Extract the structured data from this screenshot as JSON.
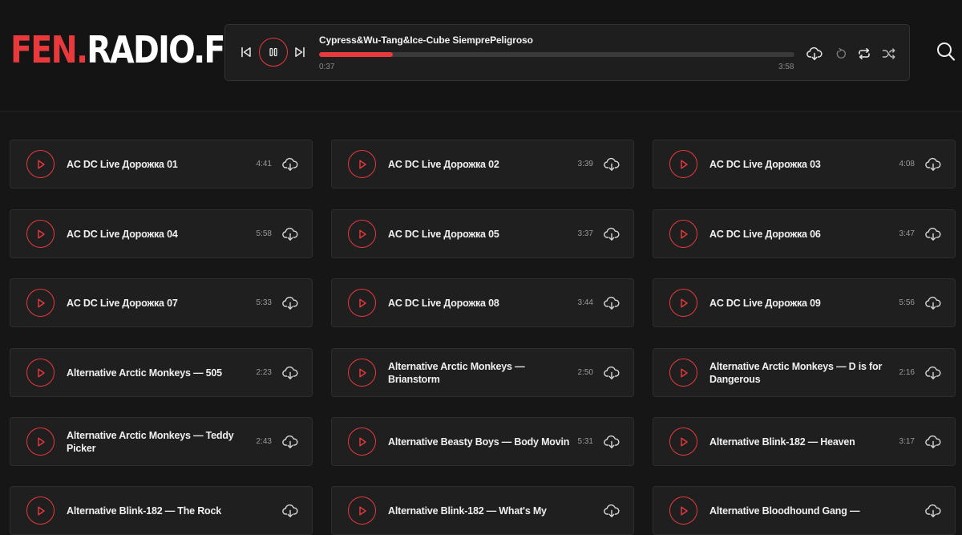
{
  "logo": {
    "accent": "FEN.",
    "main": "RADIO.FM"
  },
  "player": {
    "now_playing": "Cypress&Wu-Tang&Ice-Cube SiempreP­eligroso",
    "current_time": "0:37",
    "total_time": "3:58",
    "progress_percent": 15.5
  },
  "colors": {
    "accent": "#e8393d",
    "background": "#161616",
    "card": "#1f1f1f"
  },
  "icons": {
    "prev": "skip-previous-icon",
    "pause": "pause-icon",
    "next": "skip-next-icon",
    "download": "cloud-download-icon",
    "loop": "loop-icon",
    "repeat": "repeat-icon",
    "shuffle": "shuffle-icon",
    "search": "search-icon",
    "play": "play-icon"
  },
  "tracks": [
    {
      "title": "AC DC Live Дорожка 01",
      "duration": "4:41"
    },
    {
      "title": "AC DC Live Дорожка 02",
      "duration": "3:39"
    },
    {
      "title": "AC DC Live Дорожка 03",
      "duration": "4:08"
    },
    {
      "title": "AC DC Live Дорожка 04",
      "duration": "5:58"
    },
    {
      "title": "AC DC Live Дорожка 05",
      "duration": "3:37"
    },
    {
      "title": "AC DC Live Дорожка 06",
      "duration": "3:47"
    },
    {
      "title": "AC DC Live Дорожка 07",
      "duration": "5:33"
    },
    {
      "title": "AC DC Live Дорожка 08",
      "duration": "3:44"
    },
    {
      "title": "AC DC Live Дорожка 09",
      "duration": "5:56"
    },
    {
      "title": "Alternative Arctic Monkeys — 505",
      "duration": "2:23"
    },
    {
      "title": "Alternative Arctic Monkeys — Brianstorm",
      "duration": "2:50"
    },
    {
      "title": "Alternative Arctic Monkeys — D is for Dangerous",
      "duration": "2:16"
    },
    {
      "title": "Alternative Arctic Monkeys — Teddy Picker",
      "duration": "2:43"
    },
    {
      "title": "Alternative Beasty Boys — Body Movin",
      "duration": "5:31"
    },
    {
      "title": "Alternative Blink-182 — Heaven",
      "duration": "3:17"
    },
    {
      "title": "Alternative Blink-182 — The Rock",
      "duration": ""
    },
    {
      "title": "Alternative Blink-182 — What's My",
      "duration": ""
    },
    {
      "title": "Alternative Bloodhound Gang —",
      "duration": ""
    }
  ]
}
